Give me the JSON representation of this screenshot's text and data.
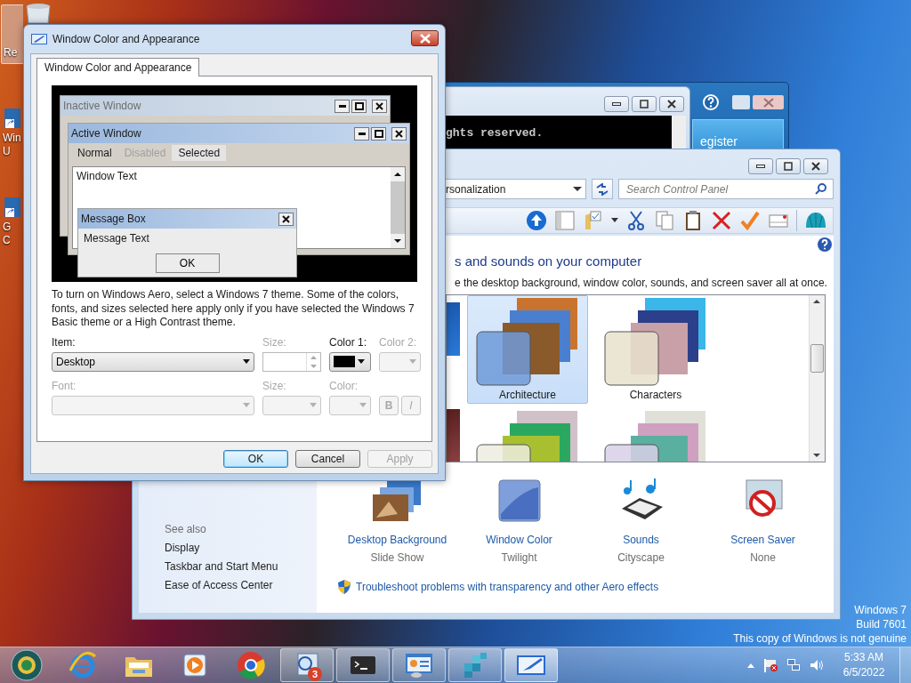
{
  "desktop": {
    "icons": [
      {
        "kind": "recycle_bin",
        "lines": [
          "Re"
        ],
        "selected": true
      },
      {
        "kind": "shortcut",
        "lines": [
          "Win",
          "U"
        ],
        "selected": false
      },
      {
        "kind": "shortcut",
        "lines": [
          "G",
          "C"
        ],
        "selected": false
      }
    ],
    "genuine_notice": [
      "Windows 7",
      "Build 7601",
      "This copy of Windows is not genuine"
    ]
  },
  "blue_window": {
    "button": "egister"
  },
  "console_window": {
    "text": "ghts reserved."
  },
  "control_panel": {
    "address": "rsonalization",
    "search": {
      "placeholder": "Search Control Panel"
    },
    "heading": "s and sounds on your computer",
    "subtitle": "e the desktop background, window color, sounds, and screen saver all at once.",
    "themes": [
      {
        "name": "Architecture",
        "selected": true
      },
      {
        "name": "Characters",
        "selected": false
      }
    ],
    "settings": [
      {
        "kind": "background",
        "label": "Desktop Background",
        "value": "Slide Show"
      },
      {
        "kind": "color",
        "label": "Window Color",
        "value": "Twilight"
      },
      {
        "kind": "sounds",
        "label": "Sounds",
        "value": "Cityscape"
      },
      {
        "kind": "screensaver",
        "label": "Screen Saver",
        "value": "None"
      }
    ],
    "troubleshoot_link": "Troubleshoot problems with transparency and other Aero effects",
    "see_also": {
      "title": "See also",
      "links": [
        "Display",
        "Taskbar and Start Menu",
        "Ease of Access Center"
      ]
    }
  },
  "dialog": {
    "title": "Window Color and Appearance",
    "tabs": [
      {
        "label": "Window Color and Appearance",
        "selected": true
      }
    ],
    "preview": {
      "inactive_title": "Inactive Window",
      "active_title": "Active Window",
      "menu": [
        {
          "label": "Normal",
          "kind": "normal"
        },
        {
          "label": "Disabled",
          "kind": "disabled"
        },
        {
          "label": "Selected",
          "kind": "selected"
        }
      ],
      "window_text": "Window Text",
      "message_box": {
        "title": "Message Box",
        "text": "Message Text",
        "button": "OK"
      }
    },
    "description": "To turn on Windows Aero, select a Windows 7 theme.  Some of the colors, fonts, and sizes selected here apply only if you have selected the Windows 7 Basic theme or a High Contrast theme.",
    "rows": [
      [
        {
          "kind": "dropdown",
          "label": "Item:",
          "value": "Desktop",
          "disabled": false
        },
        {
          "kind": "spinner",
          "label": "Size:",
          "disabled": true
        },
        {
          "kind": "color",
          "label": "Color 1:",
          "color": "#000000",
          "disabled": false
        },
        {
          "kind": "color",
          "label": "Color 2:",
          "disabled": true
        }
      ],
      [
        {
          "kind": "dropdown",
          "label": "Font:",
          "disabled": true
        },
        {
          "kind": "dropdown",
          "label": "Size:",
          "disabled": true
        },
        {
          "kind": "color",
          "label": "Color:",
          "disabled": true
        },
        {
          "kind": "styles",
          "buttons": [
            "B",
            "I"
          ],
          "disabled": true
        }
      ]
    ],
    "buttons": [
      {
        "label": "OK",
        "default": true,
        "disabled": false
      },
      {
        "label": "Cancel",
        "default": false,
        "disabled": false
      },
      {
        "label": "Apply",
        "default": false,
        "disabled": true
      }
    ]
  },
  "taskbar": {
    "items": [
      {
        "kind": "start",
        "running": false,
        "selected": false
      },
      {
        "kind": "browser",
        "running": false,
        "selected": false
      },
      {
        "kind": "explorer",
        "running": false,
        "selected": false
      },
      {
        "kind": "media",
        "running": false,
        "selected": false
      },
      {
        "kind": "chrome",
        "running": false,
        "selected": false
      },
      {
        "kind": "magnifier",
        "running": true,
        "selected": false,
        "badge": "3"
      },
      {
        "kind": "terminal",
        "running": true,
        "selected": false
      },
      {
        "kind": "control_panel",
        "running": true,
        "selected": false
      },
      {
        "kind": "registry",
        "running": true,
        "selected": false
      },
      {
        "kind": "window_color",
        "running": true,
        "selected": true
      }
    ],
    "clock": {
      "time": "5:33 AM",
      "date": "6/5/2022"
    }
  }
}
